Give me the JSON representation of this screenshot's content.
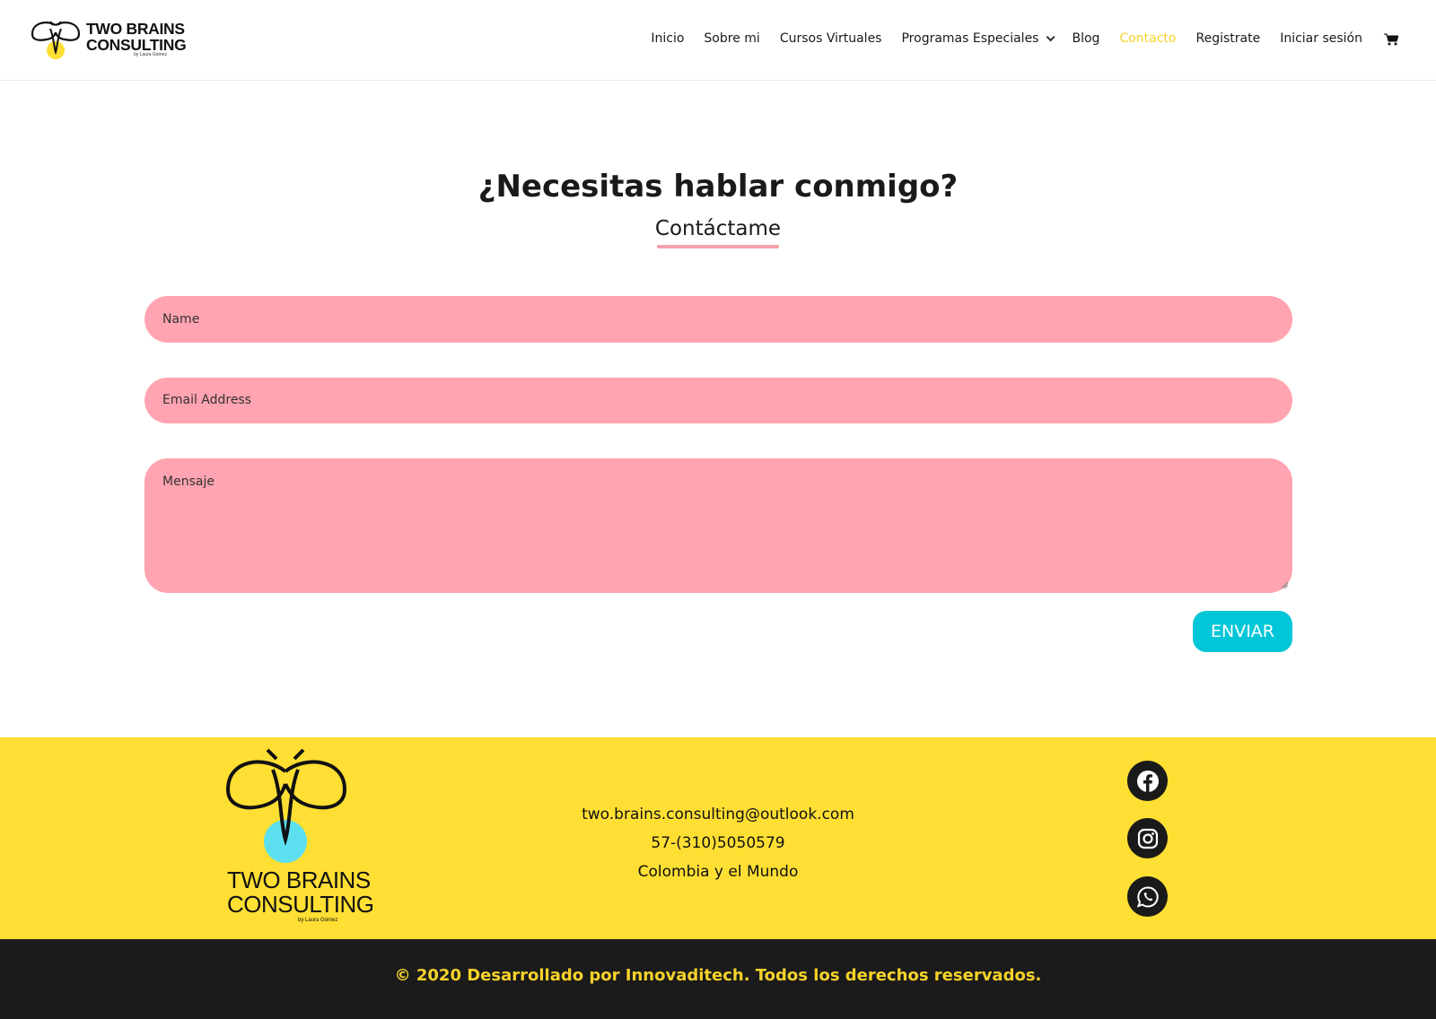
{
  "brand": {
    "name_line1": "TWO BRAINS",
    "name_line2": "CONSULTING",
    "byline": "by Laura Gómez"
  },
  "nav": {
    "items": [
      {
        "label": "Inicio",
        "active": false
      },
      {
        "label": "Sobre mi",
        "active": false
      },
      {
        "label": "Cursos Virtuales",
        "active": false
      },
      {
        "label": "Programas Especiales",
        "active": false,
        "has_dropdown": true
      },
      {
        "label": "Blog",
        "active": false
      },
      {
        "label": "Contacto",
        "active": true
      },
      {
        "label": "Registrate",
        "active": false
      },
      {
        "label": "Iniciar sesión",
        "active": false
      }
    ],
    "cart_icon": "shopping-cart-icon"
  },
  "main": {
    "heading": "¿Necesitas hablar conmigo?",
    "subheading": "Contáctame"
  },
  "form": {
    "name_placeholder": "Name",
    "email_placeholder": "Email Address",
    "message_placeholder": "Mensaje",
    "submit_label": "ENVIAR"
  },
  "footer": {
    "email": "two.brains.consulting@outlook.com",
    "phone": "57-(310)5050579",
    "location": "Colombia y el Mundo",
    "social_icons": [
      "facebook-icon",
      "instagram-icon",
      "whatsapp-icon"
    ],
    "copyright": "© 2020 Desarrollado por Innovaditech. Todos los derechos reservados."
  },
  "colors": {
    "accent_yellow": "#ffdf33",
    "nav_active": "#f6d22a",
    "field_pink": "#ffa4b0",
    "button_cyan": "#00c6d7",
    "footer_dark": "#1b1b1b"
  }
}
